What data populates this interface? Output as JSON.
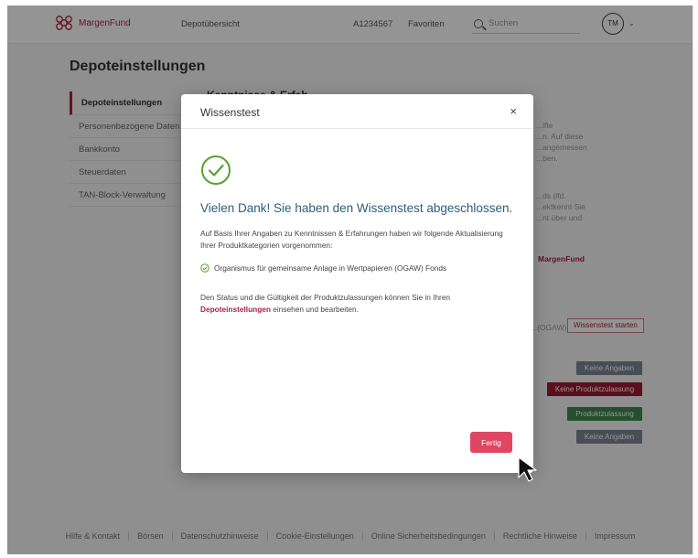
{
  "header": {
    "brand": "MargenFund",
    "nav": [
      "Depotübersicht",
      "A1234567",
      "Favoriten"
    ],
    "search_placeholder": "Suchen",
    "avatar_initials": "TM"
  },
  "page": {
    "title": "Depoteinstellungen",
    "sidebar": [
      "Depoteinstellungen",
      "Personenbezogene Daten",
      "Bankkonto",
      "Steuerdaten",
      "TAN-Block-Verwaltung"
    ]
  },
  "background": {
    "line1": "Kenntnisse & Erfah...",
    "snippet_a": [
      "...lfte",
      "...n. Auf diese",
      "...angemessen",
      "...ben."
    ],
    "snippet_b": [
      "...ds (lfd.",
      "...ektkennt Sie",
      "...nt über und"
    ],
    "red_label": "MargenFund",
    "row_label": "...(OGAW)",
    "outline_btn": "Wissenstest starten",
    "btn_gray1": "Keine Angaben",
    "btn_red": "Keine Produktzulassung",
    "btn_green": "Produktzulassung",
    "btn_gray2": "Keine Angaben"
  },
  "footer": [
    "Hilfe & Kontakt",
    "Börsen",
    "Datenschutzhinweise",
    "Cookie-Einstellungen",
    "Online Sicherheitsbedingungen",
    "Rechtliche Hinweise",
    "Impressum"
  ],
  "modal": {
    "title": "Wissenstest",
    "close": "×",
    "heading": "Vielen Dank! Sie haben den Wissenstest abgeschlossen.",
    "body": "Auf Basis Ihrer Angaben zu Kenntnissen & Erfahrungen haben wir folgende Aktualisierung Ihrer Produktkategorien vorgenommen:",
    "product": "Organismus für gemeinsame Anlage in Wertpapieren (OGAW) Fonds",
    "status_pre": "Den Status und die Gültigkeit der Produktzulassungen können Sie in Ihren",
    "status_link": "Depoteinstellungen",
    "status_post": "einsehen und bearbeiten.",
    "button": "Fertig"
  },
  "colors": {
    "brand": "#b01f47",
    "accent_button": "#e04663",
    "success": "#5aa02c",
    "heading": "#2f5e78"
  }
}
